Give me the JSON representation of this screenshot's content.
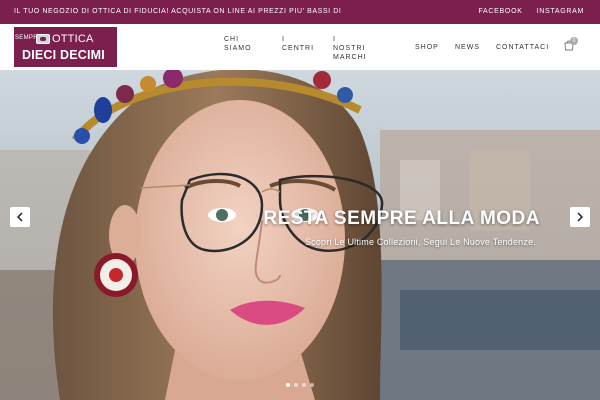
{
  "topbar": {
    "promo": "IL TUO NEGOZIO DI OTTICA DI FIDUCIA! ACQUISTA ON LINE AI PREZZI PIU' BASSI DI",
    "social": [
      "FACEBOOK",
      "INSTAGRAM"
    ]
  },
  "logo": {
    "prefix": "SEMPRE",
    "ottica": "OTTICA",
    "name": "DIECI DECIMI"
  },
  "nav": {
    "chi_siamo": [
      "CHI",
      "SIAMO"
    ],
    "centri": [
      "I",
      "CENTRI"
    ],
    "marchi": [
      "I NOSTRI",
      "MARCHI"
    ],
    "shop": "SHOP",
    "news": "NEWS",
    "contattaci": "CONTATTACI"
  },
  "cart": {
    "count": "0",
    "icon": "shopping-bag-icon"
  },
  "hero": {
    "headline": "RESTA SEMPRE ALLA MODA",
    "subline": "Scopri Le Ultime Collezioni, Segui Le Nuove Tendenze.",
    "slides": 4,
    "active_slide": 1
  },
  "colors": {
    "brand": "#7a1f4e",
    "text": "#333333",
    "white": "#ffffff"
  }
}
